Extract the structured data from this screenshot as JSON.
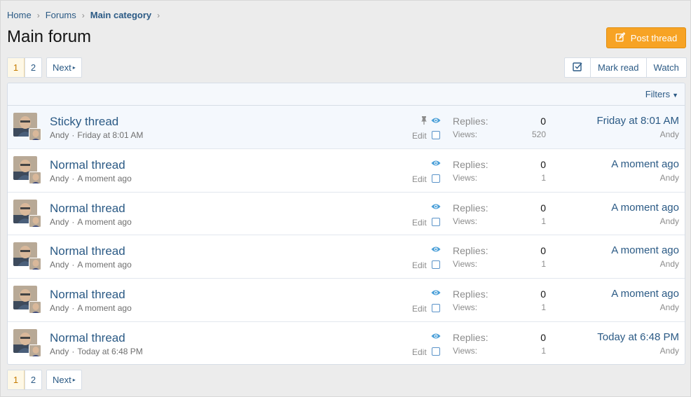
{
  "breadcrumb": [
    {
      "label": "Home"
    },
    {
      "label": "Forums"
    },
    {
      "label": "Main category"
    }
  ],
  "page_title": "Main forum",
  "post_button": "Post thread",
  "pagination": {
    "pages": [
      "1",
      "2"
    ],
    "active": "1",
    "next": "Next"
  },
  "actions": {
    "mark_read": "Mark read",
    "watch": "Watch"
  },
  "filters_label": "Filters",
  "threads": [
    {
      "title": "Sticky thread",
      "author": "Andy",
      "date": "Friday at 8:01 AM",
      "sticky": true,
      "edit": "Edit",
      "replies_label": "Replies:",
      "replies": "0",
      "views_label": "Views:",
      "views": "520",
      "latest": "Friday at 8:01 AM",
      "latest_user": "Andy"
    },
    {
      "title": "Normal thread",
      "author": "Andy",
      "date": "A moment ago",
      "sticky": false,
      "edit": "Edit",
      "replies_label": "Replies:",
      "replies": "0",
      "views_label": "Views:",
      "views": "1",
      "latest": "A moment ago",
      "latest_user": "Andy"
    },
    {
      "title": "Normal thread",
      "author": "Andy",
      "date": "A moment ago",
      "sticky": false,
      "edit": "Edit",
      "replies_label": "Replies:",
      "replies": "0",
      "views_label": "Views:",
      "views": "1",
      "latest": "A moment ago",
      "latest_user": "Andy"
    },
    {
      "title": "Normal thread",
      "author": "Andy",
      "date": "A moment ago",
      "sticky": false,
      "edit": "Edit",
      "replies_label": "Replies:",
      "replies": "0",
      "views_label": "Views:",
      "views": "1",
      "latest": "A moment ago",
      "latest_user": "Andy"
    },
    {
      "title": "Normal thread",
      "author": "Andy",
      "date": "A moment ago",
      "sticky": false,
      "edit": "Edit",
      "replies_label": "Replies:",
      "replies": "0",
      "views_label": "Views:",
      "views": "1",
      "latest": "A moment ago",
      "latest_user": "Andy"
    },
    {
      "title": "Normal thread",
      "author": "Andy",
      "date": "Today at 6:48 PM",
      "sticky": false,
      "edit": "Edit",
      "replies_label": "Replies:",
      "replies": "0",
      "views_label": "Views:",
      "views": "1",
      "latest": "Today at 6:48 PM",
      "latest_user": "Andy"
    }
  ],
  "icons": {
    "post": "edit-icon",
    "mark_all": "check-square-icon",
    "pin": "pin-icon",
    "watched": "eye-icon",
    "chevron": "chevron-right-icon",
    "caret": "caret-down-icon"
  },
  "colors": {
    "accent": "#2b5a85",
    "button": "#f7a324",
    "eye": "#4a9fd8"
  }
}
